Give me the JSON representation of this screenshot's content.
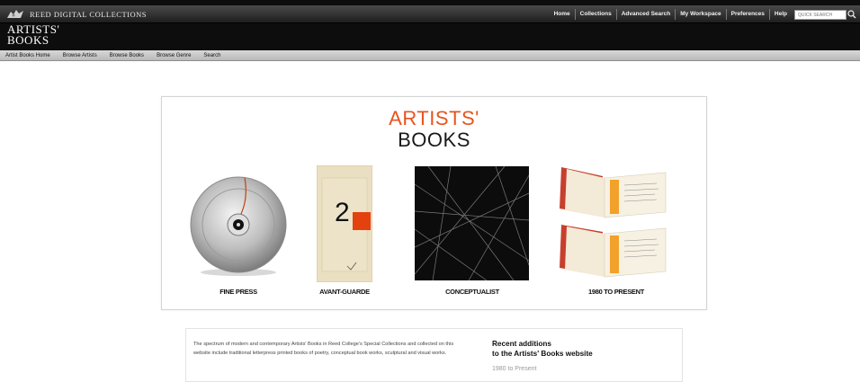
{
  "header": {
    "brand": "REED DIGITAL COLLECTIONS",
    "site_title_line1": "ARTISTS'",
    "site_title_line2": "BOOKS",
    "nav": [
      "Home",
      "Collections",
      "Advanced Search",
      "My Workspace",
      "Preferences",
      "Help"
    ],
    "search_placeholder": "QUICK SEARCH"
  },
  "subnav": [
    "Artist Books Home",
    "Browse Artists",
    "Browse Books",
    "Browse Genre",
    "Search"
  ],
  "hero": {
    "title_line1": "ARTISTS'",
    "title_line2": "BOOKS",
    "tiles": [
      {
        "caption": "FINE PRESS",
        "icon": "metal-disc-image"
      },
      {
        "caption": "AVANT-GUARDE",
        "icon": "red-square-image"
      },
      {
        "caption": "CONCEPTUALIST",
        "icon": "black-lines-image"
      },
      {
        "caption": "1980 TO PRESENT",
        "icon": "open-books-image"
      }
    ]
  },
  "info": {
    "text": "The spectrum of modern and contemporary Artists' Books in Reed College's Special Collections and collected on this website include traditional letterpress printed books of poetry, conceptual book works, sculptural and visual works.",
    "recent_title_line1": "Recent additions",
    "recent_title_line2": "to the Artists' Books website",
    "recent_link": "1980 to Present"
  },
  "colors": {
    "accent": "#e8541e",
    "header_bg": "#0d0d0d",
    "subnav_bg": "#c8c8c8"
  }
}
